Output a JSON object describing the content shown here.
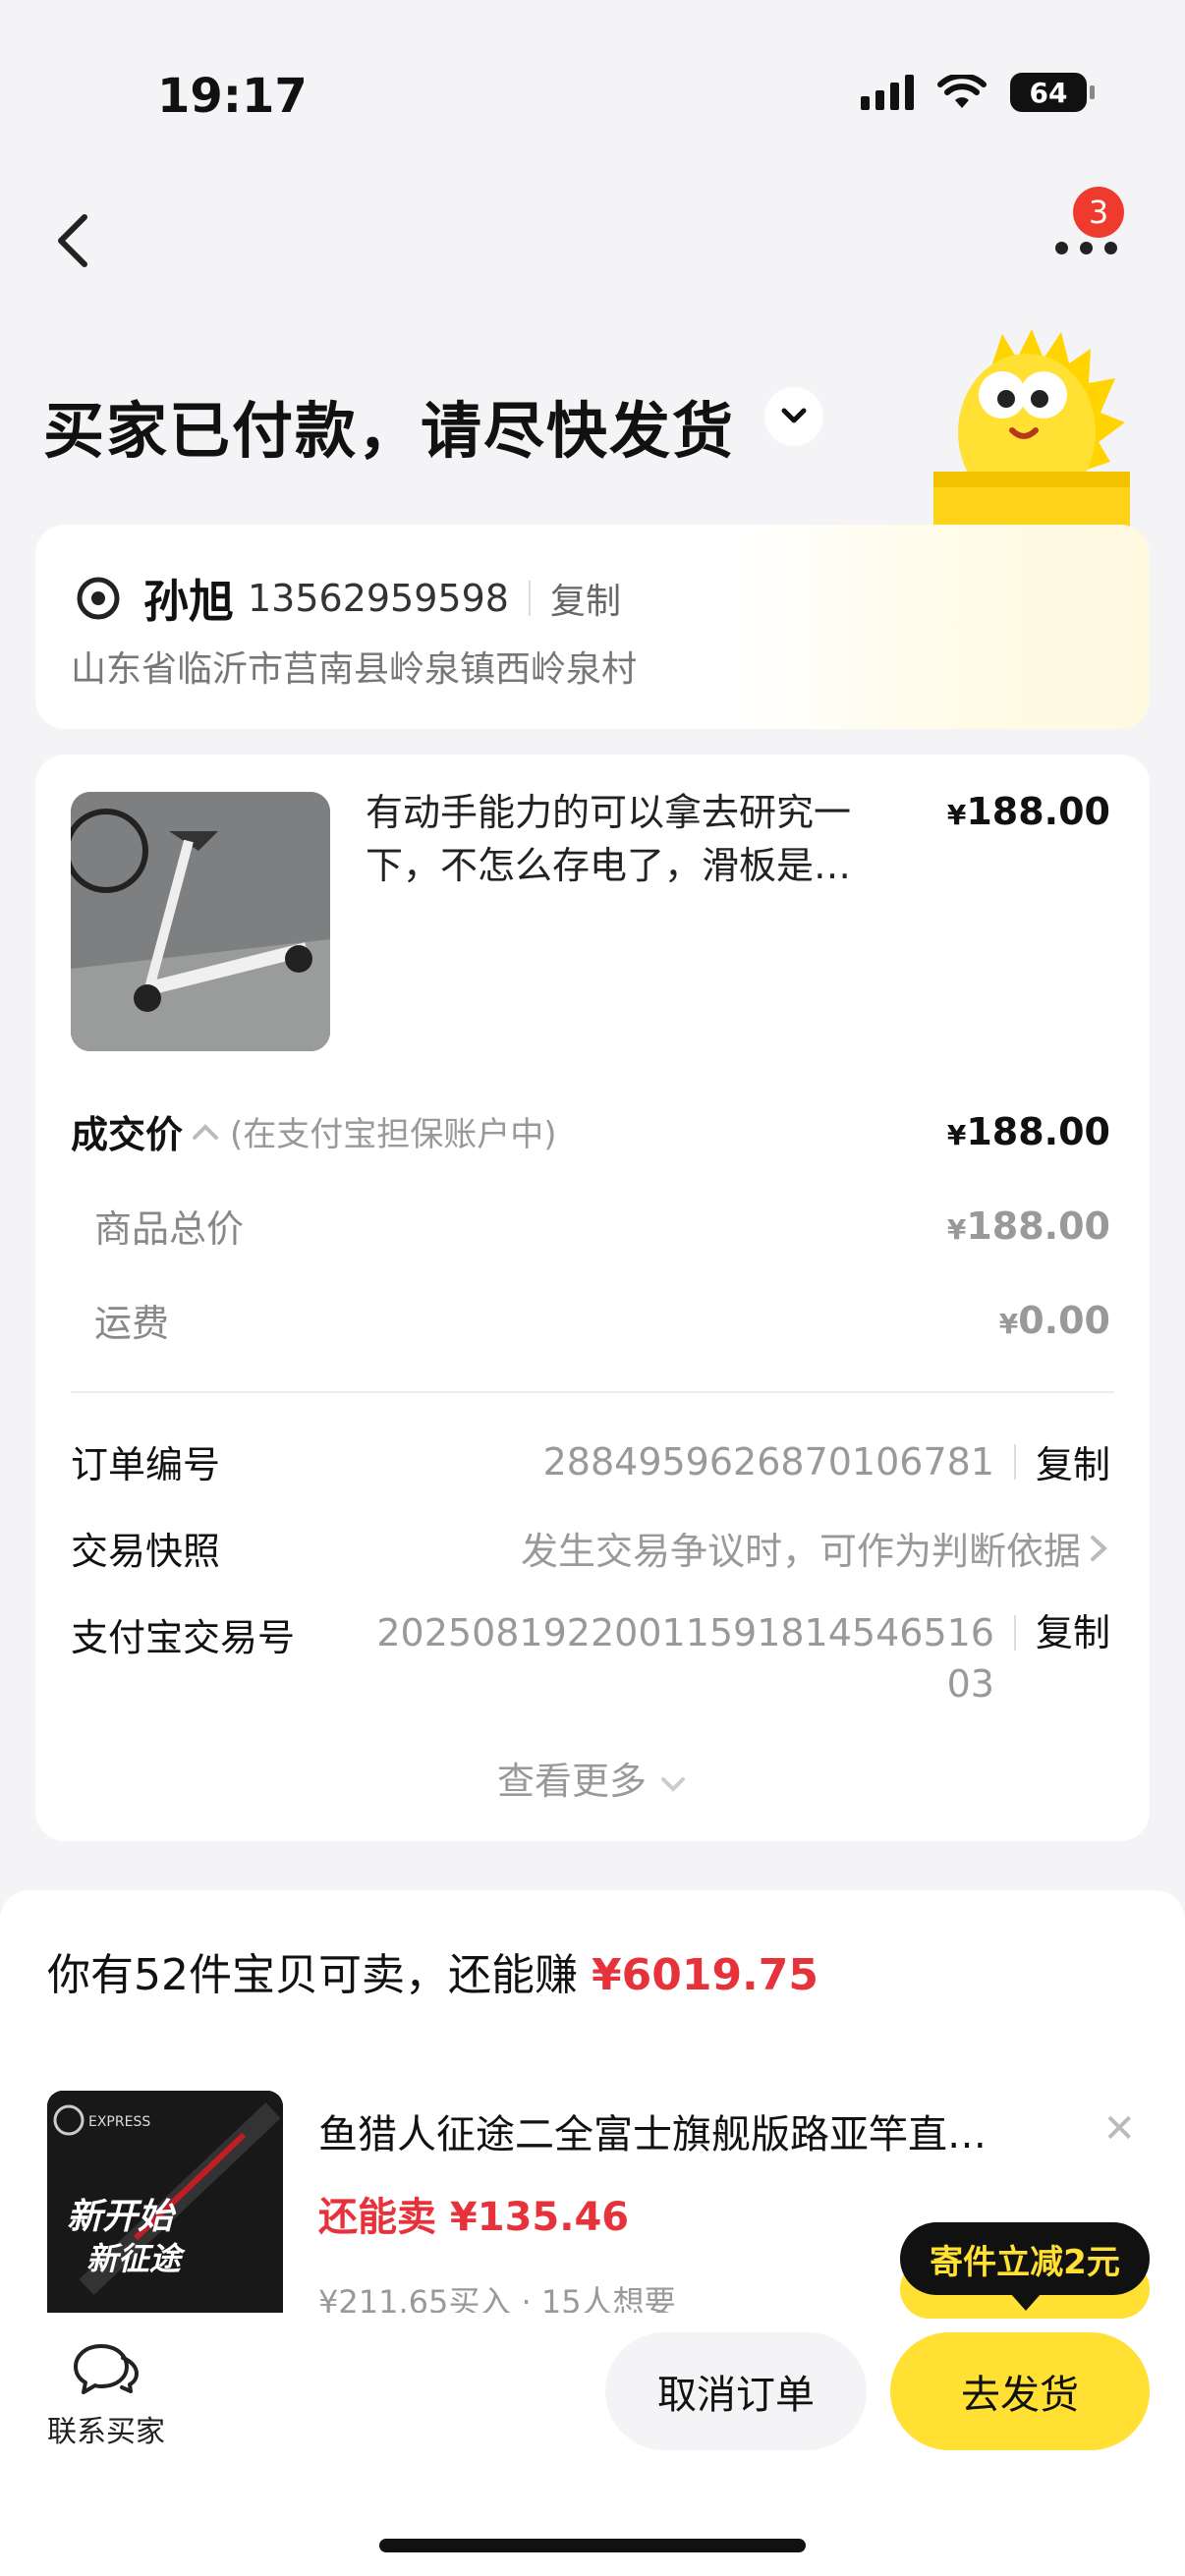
{
  "status_bar": {
    "time": "19:17",
    "battery": "64"
  },
  "header": {
    "badge_count": "3",
    "title": "买家已付款，请尽快发货"
  },
  "address": {
    "name": "孙旭",
    "phone": "13562959598",
    "copy_label": "复制",
    "full_address": "山东省临沂市莒南县岭泉镇西岭泉村"
  },
  "product": {
    "title": "有动手能力的可以拿去研究一下，不怎么存电了，滑板是…",
    "price_symbol": "¥",
    "price": "188.00"
  },
  "pricing": {
    "deal_label": "成交价",
    "deal_note": "(在支付宝担保账户中)",
    "deal_symbol": "¥",
    "deal_value": "188.00",
    "total_label": "商品总价",
    "total_symbol": "¥",
    "total_value": "188.00",
    "shipping_label": "运费",
    "shipping_symbol": "¥",
    "shipping_value": "0.00"
  },
  "order_info": {
    "order_no_label": "订单编号",
    "order_no": "2884959626870106781",
    "order_copy": "复制",
    "snapshot_label": "交易快照",
    "snapshot_value": "发生交易争议时，可作为判断依据",
    "alipay_label": "支付宝交易号",
    "alipay_no_line1": "20250819220011591814546516",
    "alipay_no_line2": "03",
    "alipay_copy": "复制",
    "see_more": "查看更多"
  },
  "recommend": {
    "headline_prefix": "你有52件宝贝可卖，还能赚 ",
    "headline_amount": "¥6019.75",
    "item_title": "鱼猎人征途二全富士旗舰版路亚竿直…",
    "item_can_sell": "还能卖 ¥135.46",
    "item_meta": "¥211.65买入 · 15人想要",
    "thumb_text_1": "EXPRESS",
    "thumb_text_2": "新开始",
    "thumb_text_3": "新征途",
    "tip": "寄件立减2元"
  },
  "bottom_bar": {
    "contact_label": "联系买家",
    "cancel_label": "取消订单",
    "ship_label": "去发货"
  },
  "colors": {
    "accent_yellow": "#ffe033",
    "price_red": "#e6323b",
    "badge_red": "#ef3b2e"
  }
}
